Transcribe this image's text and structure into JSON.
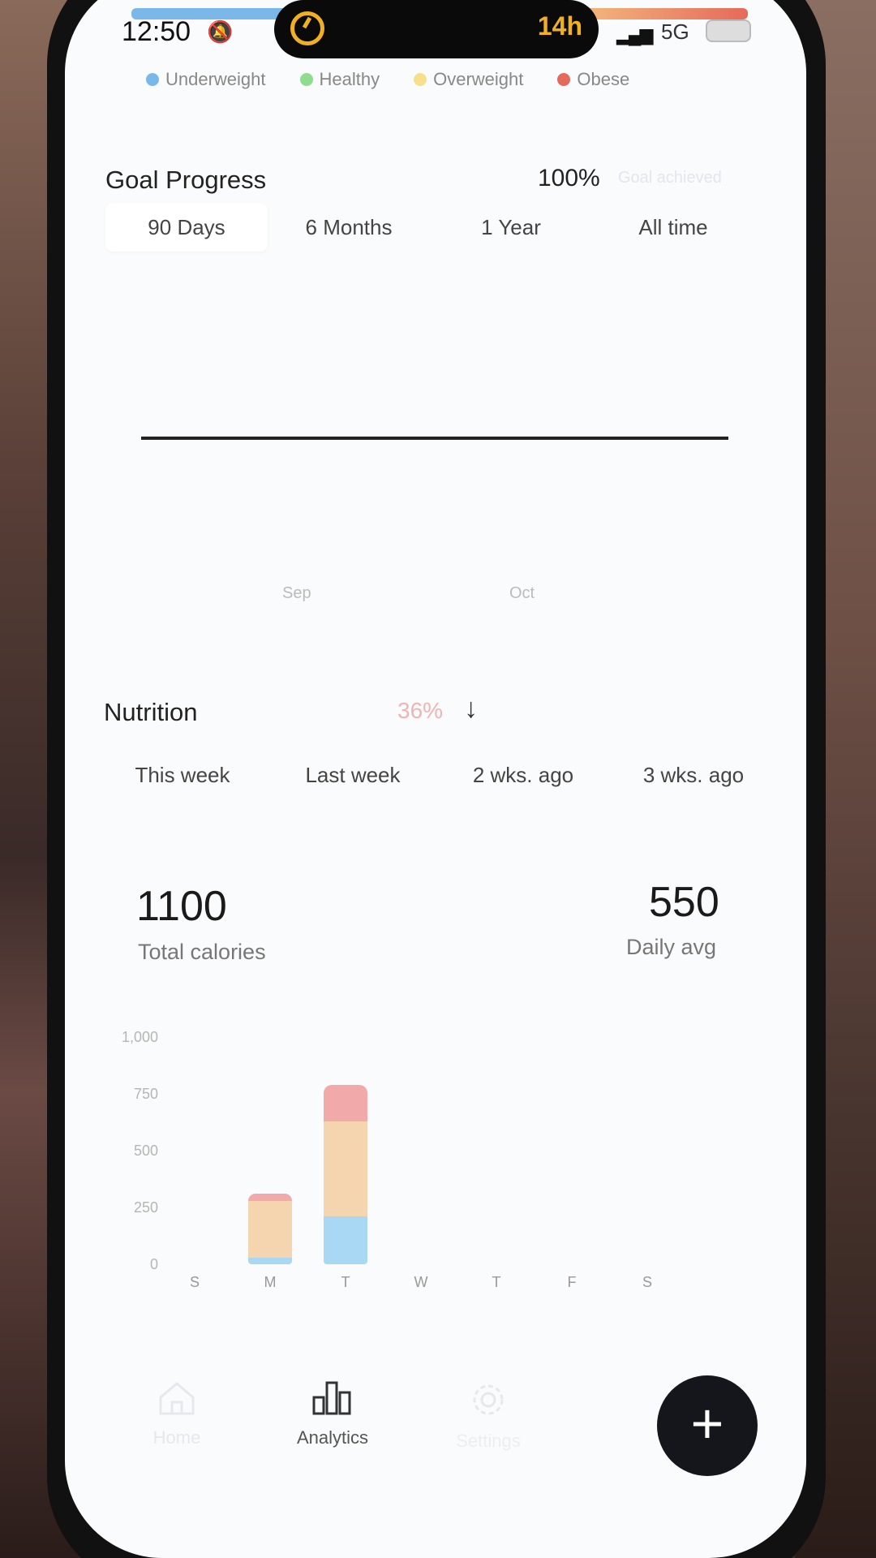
{
  "status_bar": {
    "time": "12:50",
    "activity_text": "14h",
    "network": "5G"
  },
  "bmi_legend": [
    {
      "label": "Underweight",
      "color": "#7ab8ea"
    },
    {
      "label": "Healthy",
      "color": "#8fdc8f"
    },
    {
      "label": "Overweight",
      "color": "#f7df8c"
    },
    {
      "label": "Obese",
      "color": "#e56a5a"
    }
  ],
  "goal_progress": {
    "title": "Goal Progress",
    "percent": "100%",
    "sub_label": "Goal achieved",
    "tabs": [
      {
        "label": "90 Days",
        "active": true
      },
      {
        "label": "6 Months",
        "active": false
      },
      {
        "label": "1 Year",
        "active": false
      },
      {
        "label": "All time",
        "active": false
      }
    ],
    "months": [
      "Sep",
      "Oct"
    ]
  },
  "nutrition": {
    "title": "Nutrition",
    "change": "36%",
    "weeks": [
      "This week",
      "Last week",
      "2 wks. ago",
      "3 wks. ago"
    ],
    "total_calories": "1100",
    "total_calories_label": "Total calories",
    "daily_avg": "550",
    "daily_avg_label": "Daily avg"
  },
  "chart_data": {
    "type": "bar",
    "stacked": true,
    "categories": [
      "S",
      "M",
      "T",
      "W",
      "T",
      "F",
      "S"
    ],
    "series": [
      {
        "color": "#a9d8f5",
        "values": [
          0,
          30,
          210,
          0,
          0,
          0,
          0
        ]
      },
      {
        "color": "#f5d4b0",
        "values": [
          0,
          250,
          420,
          0,
          0,
          0,
          0
        ]
      },
      {
        "color": "#f2a9a9",
        "values": [
          0,
          30,
          160,
          0,
          0,
          0,
          0
        ]
      }
    ],
    "ylim": [
      0,
      1000
    ],
    "yticks": [
      "1,000",
      "750",
      "500",
      "250",
      "0"
    ]
  },
  "bottom_nav": [
    {
      "label": "Home",
      "icon": "home-icon",
      "active": false
    },
    {
      "label": "Analytics",
      "icon": "bar-chart-icon",
      "active": true
    },
    {
      "label": "Settings",
      "icon": "gear-icon",
      "active": false
    }
  ],
  "fab_label": "+"
}
